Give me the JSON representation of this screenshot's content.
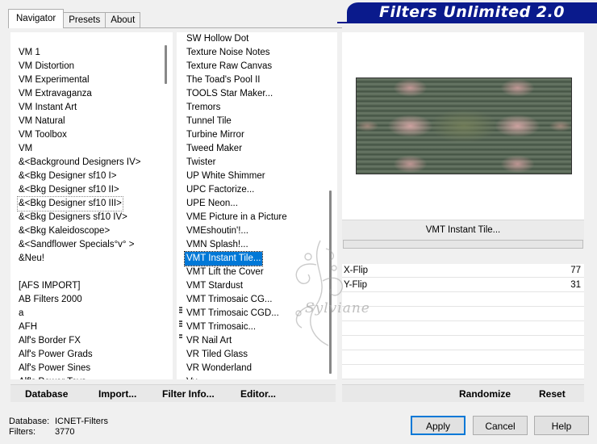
{
  "tabs": [
    "Navigator",
    "Presets",
    "About"
  ],
  "title": "Filters Unlimited 2.0",
  "categories": [
    "VM 1",
    "VM Distortion",
    "VM Experimental",
    "VM Extravaganza",
    "VM Instant Art",
    "VM Natural",
    "VM Toolbox",
    "VM",
    "&<Background Designers IV>",
    "&<Bkg Designer sf10 I>",
    "&<Bkg Designer sf10 II>",
    "&<Bkg Designer sf10 III>",
    "&<Bkg Designers sf10 IV>",
    "&<Bkg Kaleidoscope>",
    "&<Sandflower Specials°v° >",
    "&Neu!",
    "",
    "[AFS IMPORT]",
    "AB Filters 2000",
    "a",
    "AFH",
    "Alf's Border FX",
    "Alf's Power Grads",
    "Alf's Power Sines",
    "Alf's Power Toys"
  ],
  "filters": [
    "SW Hollow Dot",
    "Texture Noise Notes",
    "Texture Raw Canvas",
    "The Toad's Pool II",
    "TOOLS Star Maker...",
    "Tremors",
    "Tunnel Tile",
    "Turbine Mirror",
    "Tweed Maker",
    "Twister",
    "UP White Shimmer",
    "UPC Factorize...",
    "UPE Neon...",
    "VME Picture in a Picture",
    "VMEshoutin'!...",
    "VMN Splash!...",
    "VMT Instant Tile...",
    "VMT Lift the Cover",
    "VMT Stardust",
    "VMT Trimosaic CG...",
    "VMT Trimosaic CGD...",
    "VMT Trimosaic...",
    "VR Nail Art",
    "VR Tiled Glass",
    "VR Wonderland",
    "Vv..."
  ],
  "selected_filter": "VMT Instant Tile...",
  "params": [
    {
      "label": "X-Flip",
      "value": "77"
    },
    {
      "label": "Y-Flip",
      "value": "31"
    }
  ],
  "toolbar_left": {
    "database": "Database",
    "import": "Import...",
    "filter_info": "Filter Info...",
    "editor": "Editor..."
  },
  "toolbar_right": {
    "randomize": "Randomize",
    "reset": "Reset"
  },
  "info": {
    "database_label": "Database:",
    "database_value": "ICNET-Filters",
    "filters_label": "Filters:",
    "filters_value": "3770"
  },
  "buttons": {
    "apply": "Apply",
    "cancel": "Cancel",
    "help": "Help"
  },
  "watermark_text": "Sylviane",
  "colors": {
    "banner": "#0a1a8c",
    "selection": "#0078d7"
  },
  "icons": {
    "grip": "grip-icon"
  }
}
